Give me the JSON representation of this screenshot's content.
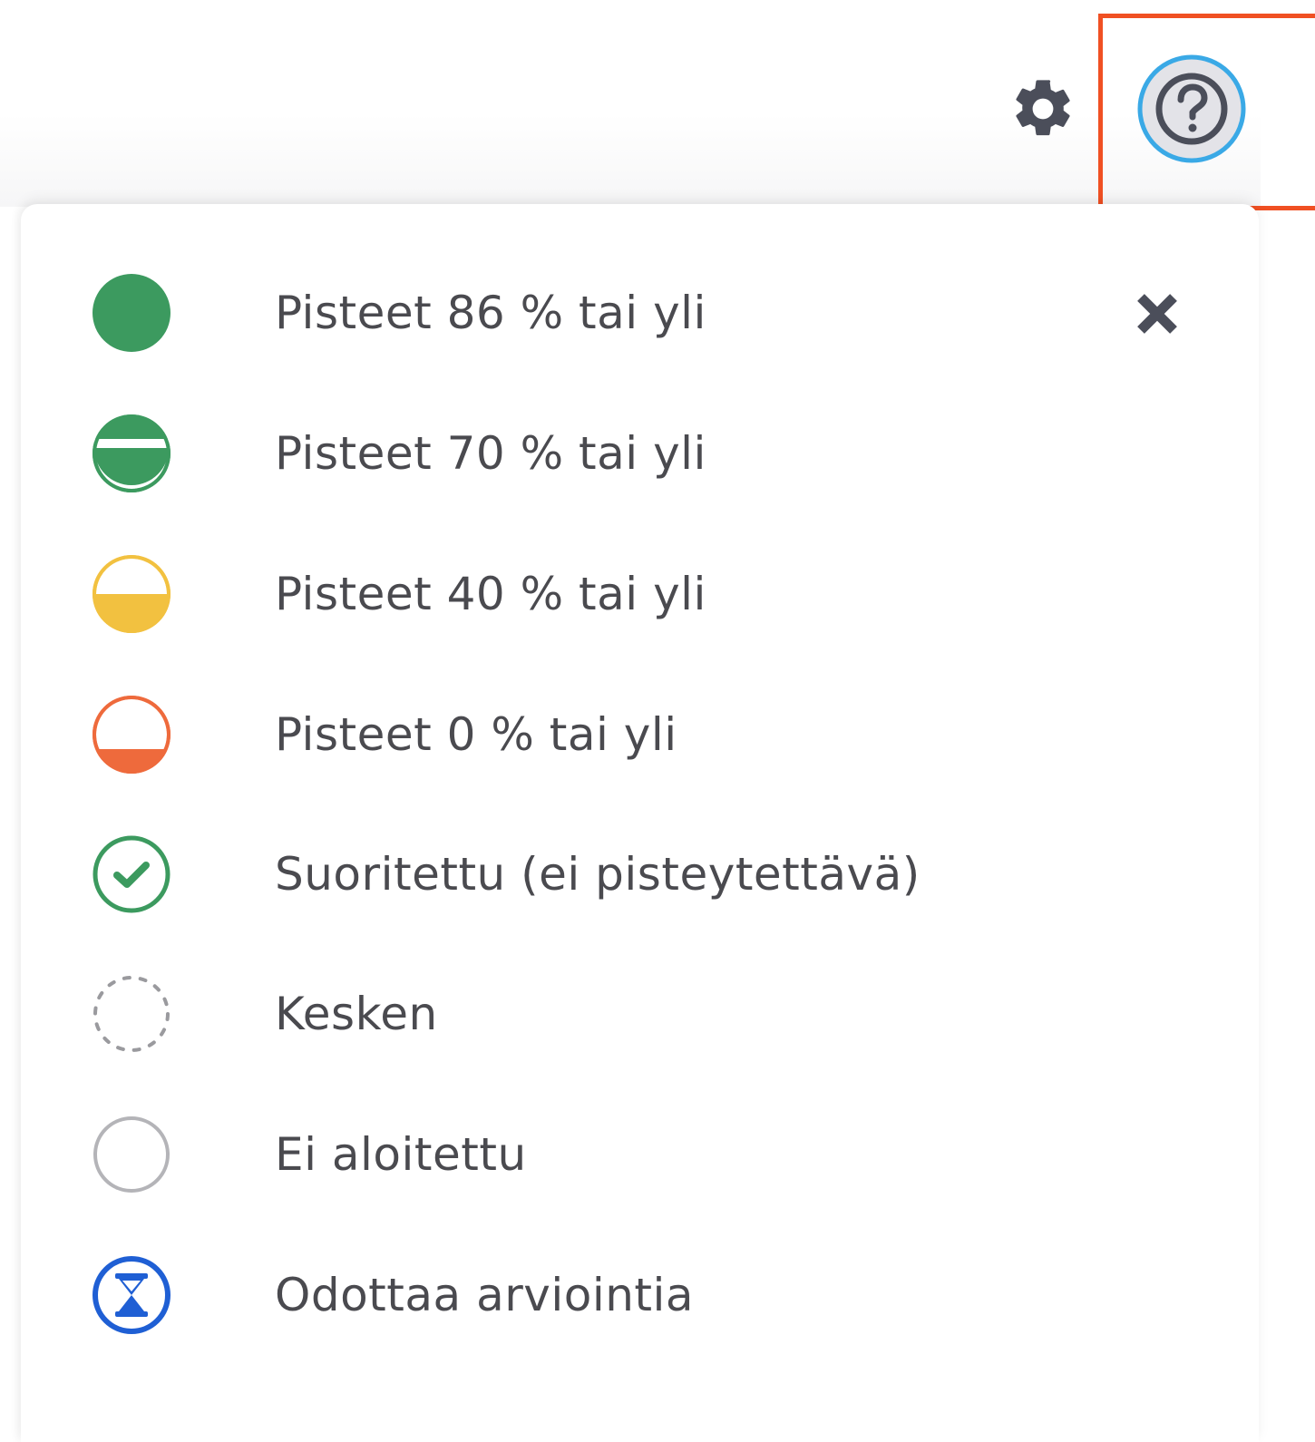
{
  "header": {
    "settings_icon": "gear-icon",
    "help_icon": "question-circle-icon",
    "help_highlighted": true
  },
  "legend": {
    "close_icon": "close-icon",
    "items": [
      {
        "label": "Pisteet 86 % tai yli",
        "icon": "full-circle-icon",
        "color": "#3c9a5f"
      },
      {
        "label": "Pisteet 70 % tai yli",
        "icon": "half-circle-icon",
        "color": "#3c9a5f"
      },
      {
        "label": "Pisteet 40 % tai yli",
        "icon": "half-circle-icon",
        "color": "#f2c140"
      },
      {
        "label": "Pisteet 0 % tai yli",
        "icon": "half-circle-icon",
        "color": "#ee6a3c"
      },
      {
        "label": "Suoritettu (ei pisteytettävä)",
        "icon": "check-circle-icon",
        "color": "#3c9a5f"
      },
      {
        "label": "Kesken",
        "icon": "dashed-circle-icon",
        "color": "#9a9a9e"
      },
      {
        "label": "Ei aloitettu",
        "icon": "empty-circle-icon",
        "color": "#b4b4b8"
      },
      {
        "label": "Odottaa arviointia",
        "icon": "hourglass-icon",
        "color": "#1f5fd4"
      }
    ]
  },
  "colors": {
    "highlight": "#f05023",
    "help_ring": "#3aa9e6",
    "icon_dark": "#4b4e5a",
    "text": "#4a4a4f"
  }
}
